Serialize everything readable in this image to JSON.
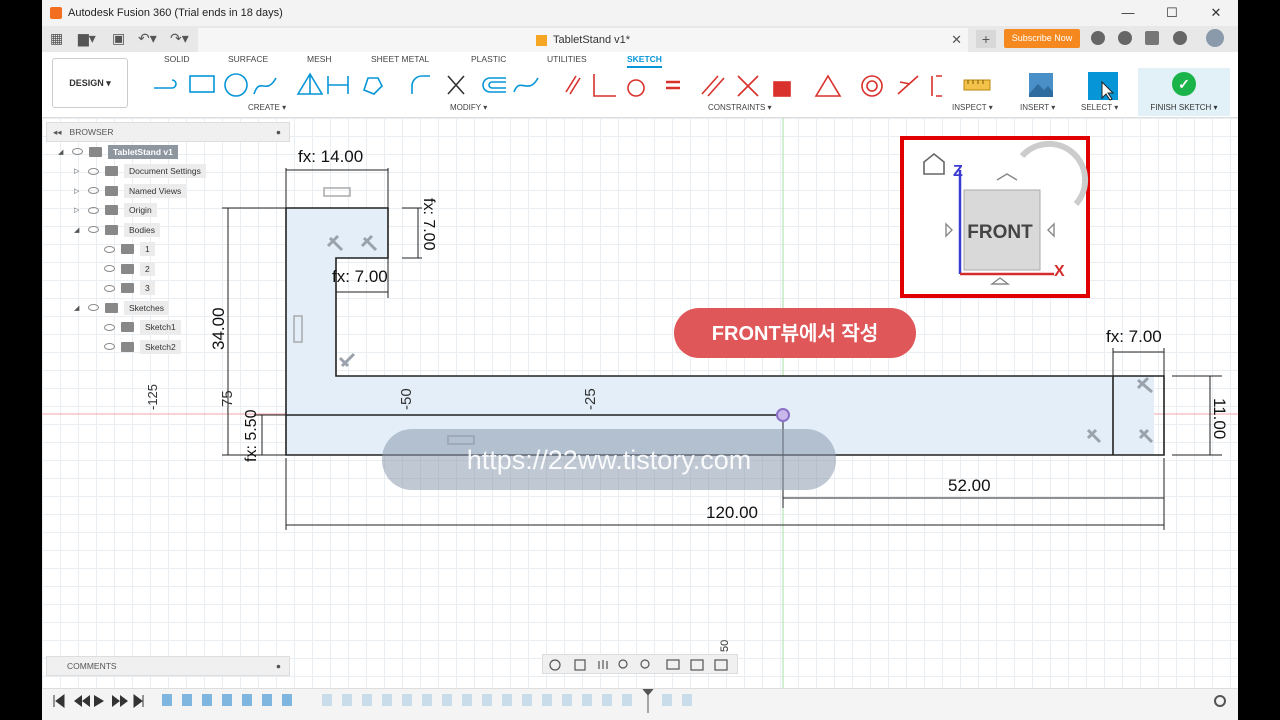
{
  "window": {
    "title": "Autodesk Fusion 360 (Trial ends in 18 days)"
  },
  "document_tab": {
    "name": "TabletStand v1*"
  },
  "header": {
    "subscribe_label": "Subscribe Now"
  },
  "workspace": {
    "label": "DESIGN ▾"
  },
  "toolbar_tabs": [
    "SOLID",
    "SURFACE",
    "MESH",
    "SHEET METAL",
    "PLASTIC",
    "UTILITIES",
    "SKETCH"
  ],
  "groups": {
    "create": "CREATE ▾",
    "modify": "MODIFY ▾",
    "constraints": "CONSTRAINTS ▾",
    "inspect": "INSPECT ▾",
    "insert": "INSERT ▾",
    "select": "SELECT ▾",
    "finish": "FINISH SKETCH ▾"
  },
  "browser": {
    "title": "BROWSER",
    "items": [
      {
        "label": "TabletStand v1",
        "depth": 0,
        "expand": "◢"
      },
      {
        "label": "Document Settings",
        "depth": 1,
        "expand": "▷"
      },
      {
        "label": "Named Views",
        "depth": 1,
        "expand": "▷"
      },
      {
        "label": "Origin",
        "depth": 1,
        "expand": "▷"
      },
      {
        "label": "Bodies",
        "depth": 1,
        "expand": "◢"
      },
      {
        "label": "1",
        "depth": 2,
        "expand": ""
      },
      {
        "label": "2",
        "depth": 2,
        "expand": ""
      },
      {
        "label": "3",
        "depth": 2,
        "expand": ""
      },
      {
        "label": "Sketches",
        "depth": 1,
        "expand": "◢"
      },
      {
        "label": "Sketch1",
        "depth": 2,
        "expand": ""
      },
      {
        "label": "Sketch2",
        "depth": 2,
        "expand": ""
      }
    ]
  },
  "comments": {
    "label": "COMMENTS"
  },
  "sketch": {
    "dims": {
      "d1": "fx: 14.00",
      "d2": "fx: 7.00",
      "d3": "fx: 7.00",
      "d4": "34.00",
      "d5": "fx: 5.50",
      "d6": "fx: 7.00",
      "d7": "11.00",
      "d8": "52.00",
      "d9": "120.00"
    },
    "axis": {
      "a1": "-125",
      "a2": "-75",
      "a3": "-50",
      "a4": "-25",
      "a5": "50"
    }
  },
  "annotation": {
    "text": "FRONT뷰에서 작성"
  },
  "watermark": {
    "text": "https://22ww.tistory.com"
  },
  "viewcube": {
    "face": "FRONT",
    "z": "Z",
    "x": "X"
  },
  "colors": {
    "accent": "#0696d7",
    "annotation": "#d9534f",
    "highlight_box": "#e00000",
    "finish": "#1bb44a"
  }
}
